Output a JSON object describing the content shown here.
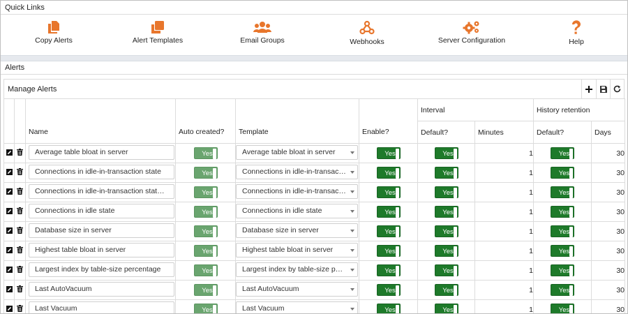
{
  "quick_links": {
    "title": "Quick Links",
    "items": [
      {
        "label": "Copy Alerts",
        "icon": "copy-icon"
      },
      {
        "label": "Alert Templates",
        "icon": "templates-icon"
      },
      {
        "label": "Email Groups",
        "icon": "users-icon"
      },
      {
        "label": "Webhooks",
        "icon": "webhook-icon"
      },
      {
        "label": "Server Configuration",
        "icon": "gears-icon"
      },
      {
        "label": "Help",
        "icon": "help-icon"
      }
    ],
    "accent": "#e8762c"
  },
  "alerts": {
    "title": "Alerts",
    "manage_title": "Manage Alerts",
    "toolbar": {
      "add": "add-icon",
      "save": "save-icon",
      "refresh": "refresh-icon"
    },
    "headers": {
      "name": "Name",
      "auto_created": "Auto created?",
      "template": "Template",
      "enable": "Enable?",
      "interval": "Interval",
      "interval_default": "Default?",
      "minutes": "Minutes",
      "history": "History retention",
      "history_default": "Default?",
      "days": "Days"
    },
    "rows": [
      {
        "name": "Average table bloat in server",
        "auto": "Yes",
        "template": "Average table bloat in server",
        "enable": "Yes",
        "int_default": "Yes",
        "minutes": "1",
        "hist_default": "Yes",
        "days": "30"
      },
      {
        "name": "Connections in idle-in-transaction state",
        "auto": "Yes",
        "template": "Connections in idle-in-transactio...",
        "enable": "Yes",
        "int_default": "Yes",
        "minutes": "1",
        "hist_default": "Yes",
        "days": "30"
      },
      {
        "name": "Connections in idle-in-transaction state, a...",
        "auto": "Yes",
        "template": "Connections in idle-in-transactio...",
        "enable": "Yes",
        "int_default": "Yes",
        "minutes": "1",
        "hist_default": "Yes",
        "days": "30"
      },
      {
        "name": "Connections in idle state",
        "auto": "Yes",
        "template": "Connections in idle state",
        "enable": "Yes",
        "int_default": "Yes",
        "minutes": "1",
        "hist_default": "Yes",
        "days": "30"
      },
      {
        "name": "Database size in server",
        "auto": "Yes",
        "template": "Database size in server",
        "enable": "Yes",
        "int_default": "Yes",
        "minutes": "1",
        "hist_default": "Yes",
        "days": "30"
      },
      {
        "name": "Highest table bloat in server",
        "auto": "Yes",
        "template": "Highest table bloat in server",
        "enable": "Yes",
        "int_default": "Yes",
        "minutes": "1",
        "hist_default": "Yes",
        "days": "30"
      },
      {
        "name": "Largest index by table-size percentage",
        "auto": "Yes",
        "template": "Largest index by table-size perce...",
        "enable": "Yes",
        "int_default": "Yes",
        "minutes": "1",
        "hist_default": "Yes",
        "days": "30"
      },
      {
        "name": "Last AutoVacuum",
        "auto": "Yes",
        "template": "Last AutoVacuum",
        "enable": "Yes",
        "int_default": "Yes",
        "minutes": "1",
        "hist_default": "Yes",
        "days": "30"
      },
      {
        "name": "Last Vacuum",
        "auto": "Yes",
        "template": "Last Vacuum",
        "enable": "Yes",
        "int_default": "Yes",
        "minutes": "1",
        "hist_default": "Yes",
        "days": "30"
      }
    ],
    "row_icons": {
      "edit": "edit-icon",
      "delete": "trash-icon"
    }
  }
}
